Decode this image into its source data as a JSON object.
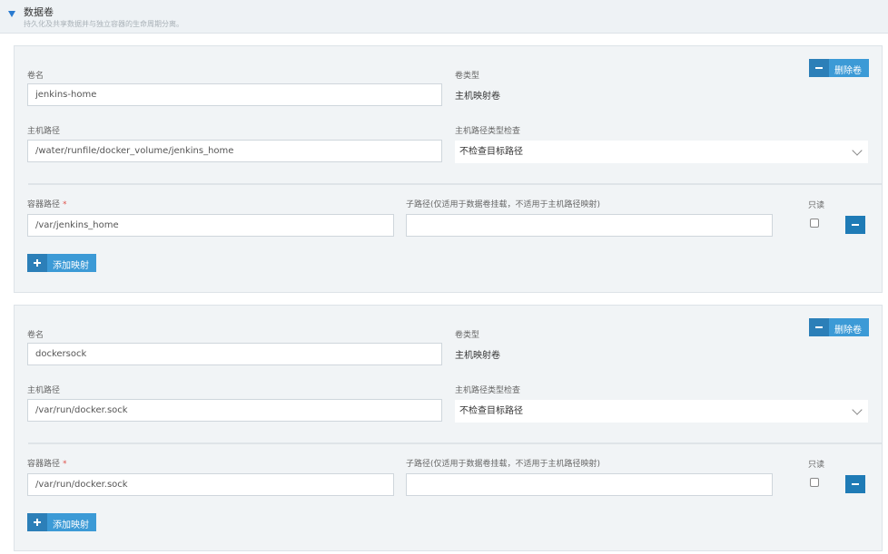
{
  "section": {
    "title": "数据卷",
    "description": "持久化及共享数据并与独立容器的生命周期分离。"
  },
  "labels": {
    "volume_name": "卷名",
    "volume_type": "卷类型",
    "host_path": "主机路径",
    "host_path_check": "主机路径类型检查",
    "container_path": "容器路径",
    "required_mark": "*",
    "sub_path": "子路径(仅适用于数据卷挂载，不适用于主机路径映射)",
    "readonly": "只读",
    "delete_volume": "删除卷",
    "add_mapping": "添加映射"
  },
  "volumes": [
    {
      "name": "jenkins-home",
      "type": "主机映射卷",
      "host_path": "/water/runfile/docker_volume/jenkins_home",
      "host_path_check": "不检查目标路径",
      "mappings": [
        {
          "container_path": "/var/jenkins_home",
          "sub_path": "",
          "readonly": false
        }
      ]
    },
    {
      "name": "dockersock",
      "type": "主机映射卷",
      "host_path": "/var/run/docker.sock",
      "host_path_check": "不检查目标路径",
      "mappings": [
        {
          "container_path": "/var/run/docker.sock",
          "sub_path": "",
          "readonly": false
        }
      ]
    }
  ]
}
